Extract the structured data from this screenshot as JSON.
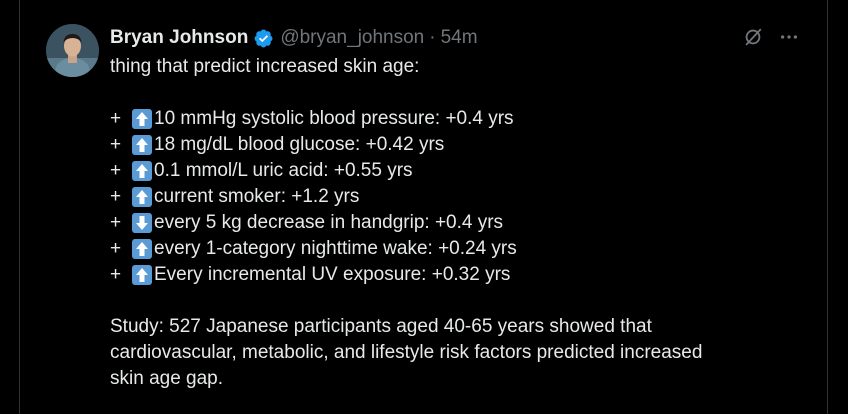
{
  "tweet": {
    "author_name": "Bryan Johnson",
    "handle": "@bryan_johnson",
    "separator": "·",
    "time": "54m",
    "intro": "thing that predict increased skin age:",
    "factors": [
      {
        "prefix": "+",
        "arrow": "up-arrow-icon",
        "text": "10 mmHg systolic blood pressure: +0.4 yrs"
      },
      {
        "prefix": "+",
        "arrow": "up-arrow-icon",
        "text": "18 mg/dL blood glucose: +0.42 yrs"
      },
      {
        "prefix": "+",
        "arrow": "up-arrow-icon",
        "text": "0.1 mmol/L uric acid: +0.55 yrs"
      },
      {
        "prefix": "+",
        "arrow": "up-arrow-icon",
        "text": "current smoker: +1.2 yrs"
      },
      {
        "prefix": "+",
        "arrow": "down-arrow-icon",
        "text": "every 5 kg decrease in handgrip: +0.4 yrs"
      },
      {
        "prefix": "+",
        "arrow": "up-arrow-icon",
        "text": "every 1-category nighttime wake: +0.24 yrs"
      },
      {
        "prefix": "+",
        "arrow": "up-arrow-icon",
        "text": "Every incremental UV exposure: +0.32 yrs"
      }
    ],
    "study_lines": [
      "Study: 527 Japanese participants aged 40-65 years showed that",
      "cardiovascular, metabolic, and lifestyle risk factors predicted increased",
      "skin age gap."
    ]
  },
  "colors": {
    "background": "#000000",
    "text": "#e7e9ea",
    "muted": "#71767b",
    "verified": "#1d9bf0",
    "emoji_bg": "#5b9bd5",
    "divider": "#2f3336"
  },
  "icons": {
    "verified": "verified-badge-icon",
    "grok": "grok-icon",
    "more": "more-options-icon"
  }
}
